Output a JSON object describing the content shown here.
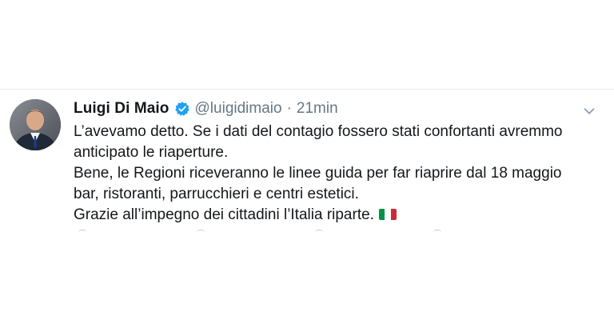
{
  "tweet": {
    "author": {
      "display_name": "Luigi Di Maio",
      "handle": "@luigidimaio",
      "verified": true,
      "avatar_icon": "profile-photo"
    },
    "separator": "·",
    "timestamp": "21min",
    "menu_icon": "chevron-down-icon",
    "text_lines": [
      "L’avevamo detto. Se i dati del contagio fossero stati confortanti avremmo",
      "anticipato le riaperture.",
      "Bene, le Regioni riceveranno le linee guida per far riaprire dal 18 maggio",
      "bar, ristoranti, parrucchieri e centri estetici.",
      "Grazie all’impegno dei cittadini l’Italia riparte."
    ],
    "emoji": "italian-flag",
    "colors": {
      "name": "#14171a",
      "secondary": "#657786",
      "verified": "#1da1f2",
      "flag": [
        "#009246",
        "#ffffff",
        "#ce2b37"
      ]
    }
  }
}
